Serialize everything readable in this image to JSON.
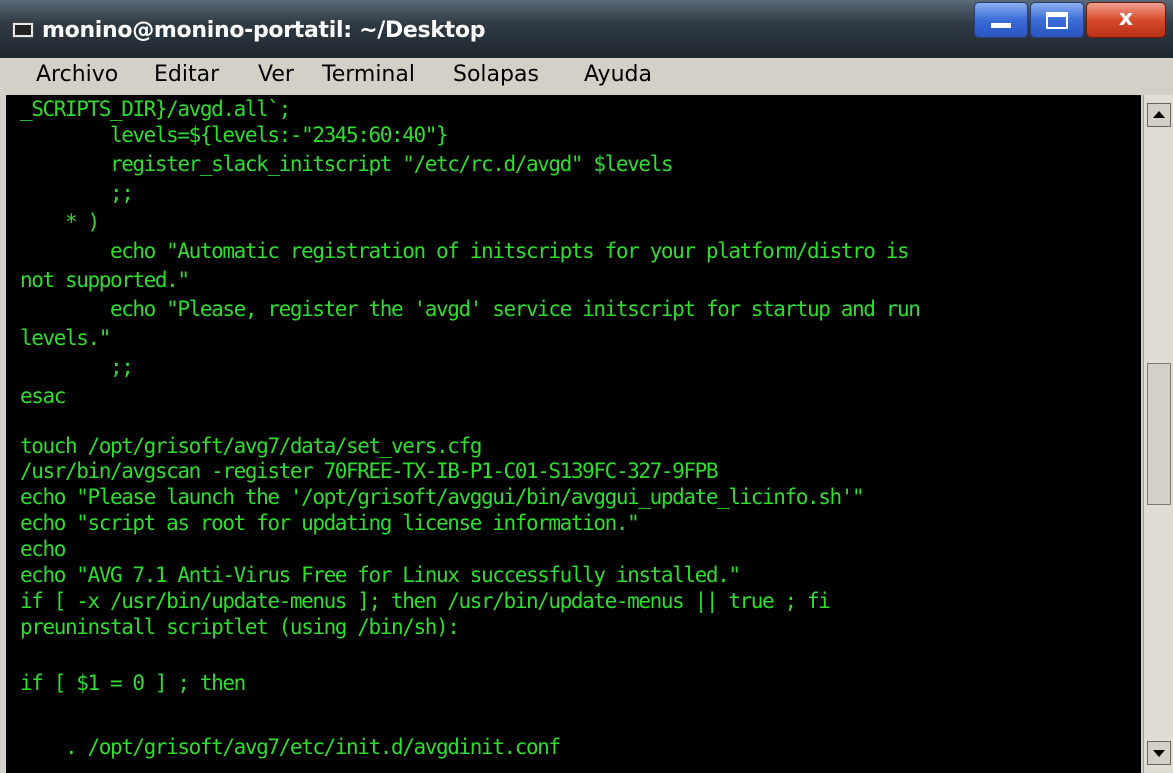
{
  "window": {
    "title": "monino@monino-portatil: ~/Desktop",
    "minimize_label": "",
    "maximize_label": "",
    "close_label": "x"
  },
  "menubar": {
    "items": [
      "Archivo",
      "Editar",
      "Ver",
      "Terminal",
      "Solapas",
      "Ayuda"
    ]
  },
  "terminal": {
    "text_color": "#2fdc2f",
    "background": "#000000",
    "lines": [
      "_SCRIPTS_DIR}/avgd.all`;",
      "        levels=${levels:-\"2345:60:40\"}",
      "        register_slack_initscript \"/etc/rc.d/avgd\" $levels",
      "        ;;",
      "    * )",
      "        echo \"Automatic registration of initscripts for your platform/distro is",
      "not supported.\"",
      "        echo \"Please, register the 'avgd' service initscript for startup and run",
      "levels.\"",
      "        ;;",
      "esac",
      "",
      "touch /opt/grisoft/avg7/data/set_vers.cfg",
      "/usr/bin/avgscan -register 70FREE-TX-IB-P1-C01-S139FC-327-9FPB",
      "echo \"Please launch the '/opt/grisoft/avggui/bin/avggui_update_licinfo.sh'\"",
      "echo \"script as root for updating license information.\"",
      "echo",
      "echo \"AVG 7.1 Anti-Virus Free for Linux successfully installed.\"",
      "if [ -x /usr/bin/update-menus ]; then /usr/bin/update-menus || true ; fi",
      "preuninstall scriptlet (using /bin/sh):",
      "",
      "if [ $1 = 0 ] ; then",
      "",
      "",
      "    . /opt/grisoft/avg7/etc/init.d/avgdinit.conf"
    ]
  },
  "scrollbar": {
    "position_fraction": 0.5
  }
}
